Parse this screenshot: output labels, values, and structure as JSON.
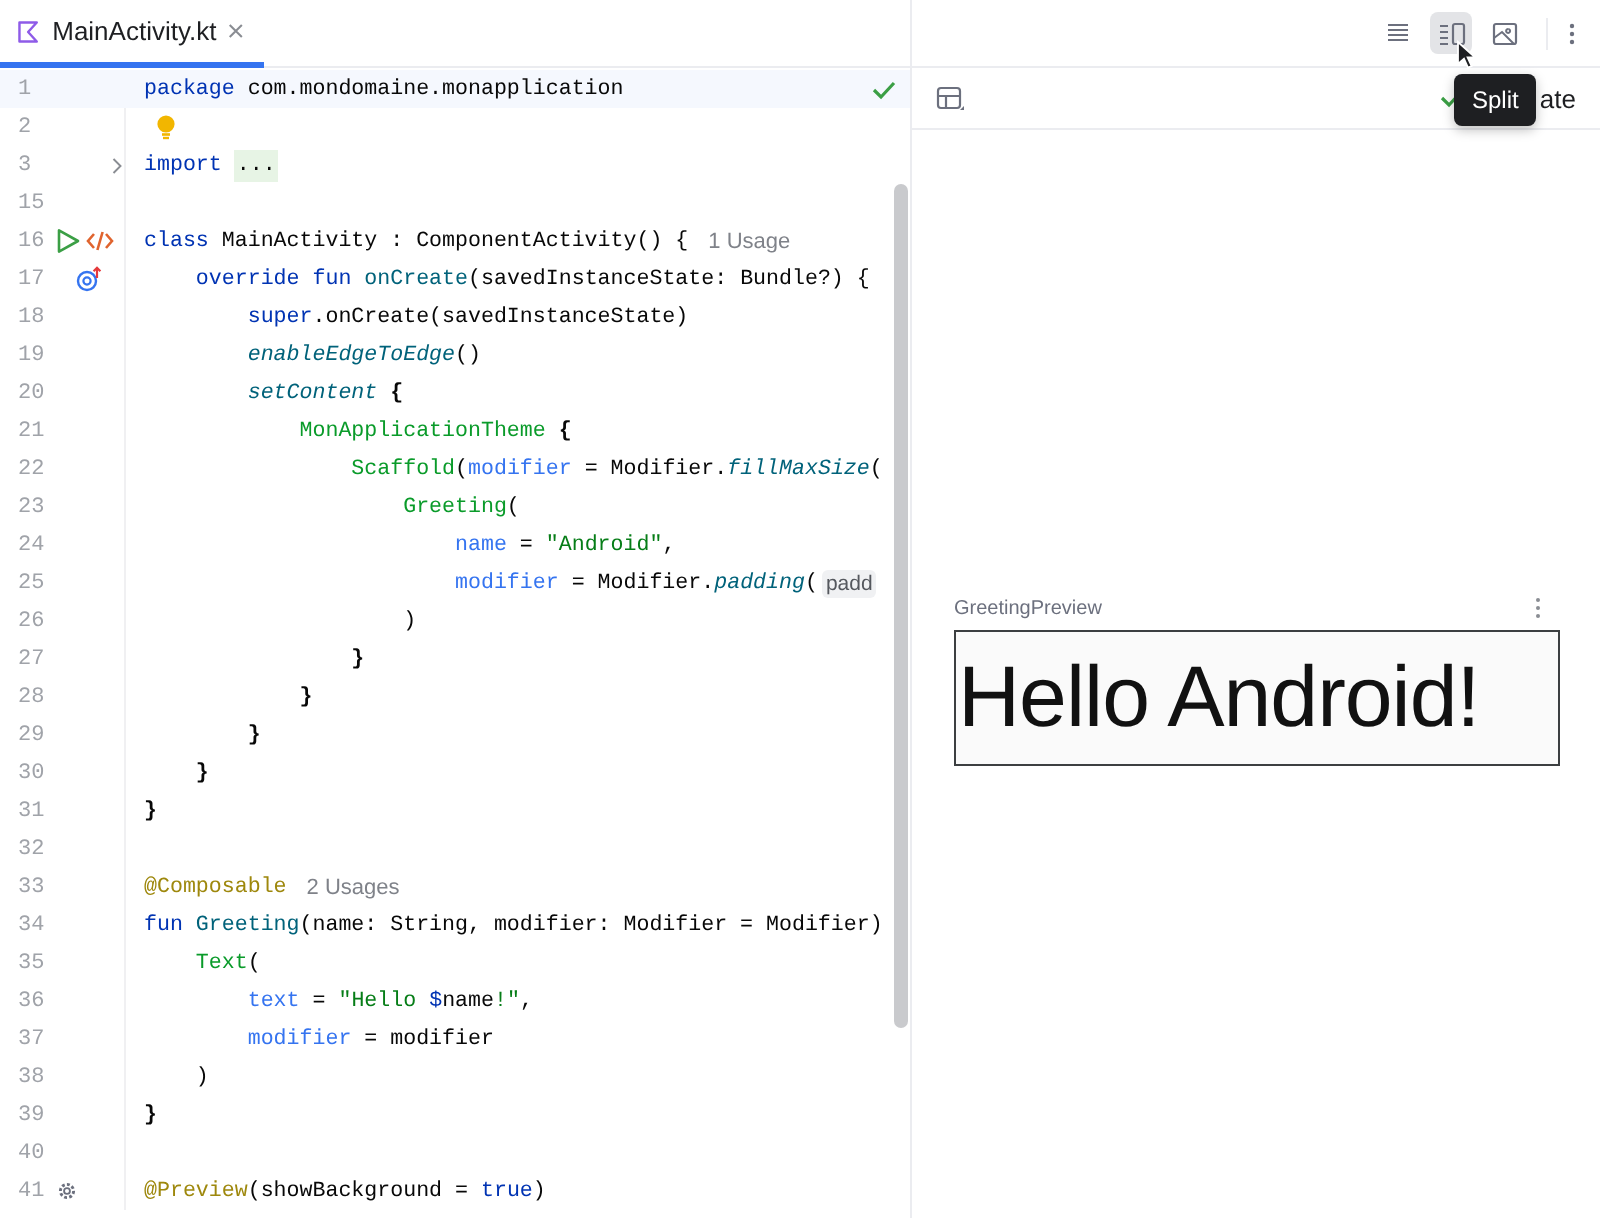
{
  "editor": {
    "tab": {
      "label": "MainActivity.kt",
      "selected": true
    },
    "lines": [
      {
        "number": "1",
        "current": true,
        "inspection_ok": true,
        "tokens": [
          {
            "kind": "kw",
            "t": "package"
          },
          {
            "kind": "plain",
            "t": " com.mondomaine.monapplication"
          }
        ]
      },
      {
        "number": "2",
        "current": false,
        "marker": {
          "kind": "bulb"
        }
      },
      {
        "number": "3",
        "current": false,
        "gutter": [
          {
            "kind": "fold"
          }
        ],
        "tokens": [
          {
            "kind": "kw",
            "t": "import "
          },
          {
            "kind": "folded",
            "t": "..."
          }
        ]
      },
      {
        "number": "15",
        "current": false
      },
      {
        "number": "16",
        "current": false,
        "gutter": [
          {
            "kind": "run"
          },
          {
            "kind": "code"
          }
        ],
        "tokens": [
          {
            "kind": "kw",
            "t": "class"
          },
          {
            "kind": "plain",
            "t": " MainActivity : ComponentActivity() {"
          }
        ],
        "hint": "1 Usage"
      },
      {
        "number": "17",
        "current": false,
        "gutter": [
          {
            "kind": "override"
          }
        ],
        "tokens": [
          {
            "kind": "kw",
            "t": "    override fun "
          },
          {
            "kind": "decl",
            "t": "onCreate"
          },
          {
            "kind": "plain",
            "t": "(savedInstanceState: Bundle?) {"
          }
        ]
      },
      {
        "number": "18",
        "current": false,
        "tokens": [
          {
            "kind": "kw",
            "t": "        super"
          },
          {
            "kind": "plain",
            "t": ".onCreate(savedInstanceState)"
          }
        ]
      },
      {
        "number": "19",
        "current": false,
        "tokens": [
          {
            "kind": "ital",
            "t": "        enableEdgeToEdge"
          },
          {
            "kind": "plain",
            "t": "()"
          }
        ]
      },
      {
        "number": "20",
        "current": false,
        "tokens": [
          {
            "kind": "ital",
            "t": "        setContent"
          },
          {
            "kind": "brace",
            "t": " {"
          }
        ]
      },
      {
        "number": "21",
        "current": false,
        "tokens": [
          {
            "kind": "comp",
            "t": "            MonApplicationTheme"
          },
          {
            "kind": "brace",
            "t": " {"
          }
        ]
      },
      {
        "number": "22",
        "current": false,
        "tokens": [
          {
            "kind": "comp",
            "t": "                Scaffold"
          },
          {
            "kind": "plain",
            "t": "("
          },
          {
            "kind": "param",
            "t": "modifier"
          },
          {
            "kind": "plain",
            "t": " = Modifier."
          },
          {
            "kind": "ital",
            "t": "fillMaxSize"
          },
          {
            "kind": "plain",
            "t": "("
          }
        ]
      },
      {
        "number": "23",
        "current": false,
        "tokens": [
          {
            "kind": "comp",
            "t": "                    Greeting"
          },
          {
            "kind": "plain",
            "t": "("
          }
        ]
      },
      {
        "number": "24",
        "current": false,
        "tokens": [
          {
            "kind": "param",
            "t": "                        name"
          },
          {
            "kind": "plain",
            "t": " = "
          },
          {
            "kind": "str",
            "t": "\"Android\""
          },
          {
            "kind": "plain",
            "t": ","
          }
        ]
      },
      {
        "number": "25",
        "current": false,
        "tokens": [
          {
            "kind": "param",
            "t": "                        modifier"
          },
          {
            "kind": "plain",
            "t": " = Modifier."
          },
          {
            "kind": "ital",
            "t": "padding"
          },
          {
            "kind": "plain",
            "t": "("
          }
        ],
        "inlay": "padd"
      },
      {
        "number": "26",
        "current": false,
        "tokens": [
          {
            "kind": "plain",
            "t": "                    )"
          }
        ]
      },
      {
        "number": "27",
        "current": false,
        "tokens": [
          {
            "kind": "brace",
            "t": "                }"
          }
        ]
      },
      {
        "number": "28",
        "current": false,
        "tokens": [
          {
            "kind": "brace",
            "t": "            }"
          }
        ]
      },
      {
        "number": "29",
        "current": false,
        "tokens": [
          {
            "kind": "brace",
            "t": "        }"
          }
        ]
      },
      {
        "number": "30",
        "current": false,
        "tokens": [
          {
            "kind": "brace",
            "t": "    }"
          }
        ]
      },
      {
        "number": "31",
        "current": false,
        "tokens": [
          {
            "kind": "brace",
            "t": "}"
          }
        ]
      },
      {
        "number": "32",
        "current": false
      },
      {
        "number": "33",
        "current": false,
        "tokens": [
          {
            "kind": "ann",
            "t": "@Composable"
          }
        ],
        "hint": "2 Usages"
      },
      {
        "number": "34",
        "current": false,
        "tokens": [
          {
            "kind": "kw",
            "t": "fun "
          },
          {
            "kind": "decl",
            "t": "Greeting"
          },
          {
            "kind": "plain",
            "t": "(name: String, modifier: Modifier = Modifier)"
          }
        ]
      },
      {
        "number": "35",
        "current": false,
        "tokens": [
          {
            "kind": "comp",
            "t": "    Text"
          },
          {
            "kind": "plain",
            "t": "("
          }
        ]
      },
      {
        "number": "36",
        "current": false,
        "tokens": [
          {
            "kind": "param",
            "t": "        text"
          },
          {
            "kind": "plain",
            "t": " = "
          },
          {
            "kind": "str",
            "t": "\"Hello "
          },
          {
            "kind": "kw",
            "t": "$"
          },
          {
            "kind": "plain",
            "t": "name"
          },
          {
            "kind": "str",
            "t": "!\""
          },
          {
            "kind": "plain",
            "t": ","
          }
        ]
      },
      {
        "number": "37",
        "current": false,
        "tokens": [
          {
            "kind": "param",
            "t": "        modifier"
          },
          {
            "kind": "plain",
            "t": " = modifier"
          }
        ]
      },
      {
        "number": "38",
        "current": false,
        "tokens": [
          {
            "kind": "plain",
            "t": "    )"
          }
        ]
      },
      {
        "number": "39",
        "current": false,
        "tokens": [
          {
            "kind": "brace",
            "t": "}"
          }
        ]
      },
      {
        "number": "40",
        "current": false
      },
      {
        "number": "41",
        "current": false,
        "gutter": [
          {
            "kind": "gear"
          }
        ],
        "tokens": [
          {
            "kind": "ann",
            "t": "@Preview"
          },
          {
            "kind": "plain",
            "t": "(showBackground = "
          },
          {
            "kind": "kw",
            "t": "true"
          },
          {
            "kind": "plain",
            "t": ")"
          }
        ]
      }
    ]
  },
  "view_modes": [
    {
      "kind": "code",
      "selected": false
    },
    {
      "kind": "split",
      "selected": true
    },
    {
      "kind": "design",
      "selected": false
    }
  ],
  "preview": {
    "status": "ate",
    "tooltip": "Split",
    "card_title": "GreetingPreview",
    "rendered_text": "Hello Android!"
  }
}
